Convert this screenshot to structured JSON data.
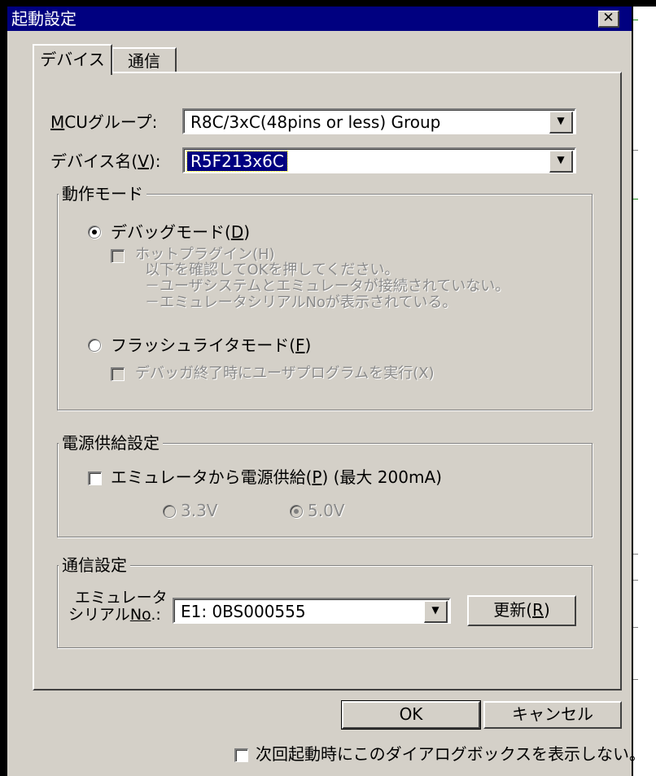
{
  "window": {
    "title": "起動設定",
    "close_icon": "close-icon"
  },
  "tabs": [
    {
      "label": "デバイス",
      "active": true
    },
    {
      "label": "通信",
      "active": false
    }
  ],
  "mcu_group": {
    "label": "MCUグループ:",
    "accel": "M",
    "value": "R8C/3xC(48pins or less) Group"
  },
  "device_name": {
    "label_pre": "デバイス名(",
    "accel": "V",
    "label_post": "):",
    "value": "R5F213x6C"
  },
  "operation_mode": {
    "legend": "動作モード",
    "debug_mode": {
      "label_pre": "デバッグモード(",
      "accel": "D",
      "label_post": ")",
      "checked": true
    },
    "hot_plugin": {
      "label": "ホットプラグイン(H)",
      "note_line1": "以下を確認してOKを押してください。",
      "note_line2": "－ユーザシステムとエミュレータが接続されていない。",
      "note_line3": "－エミュレータシリアルNoが表示されている。",
      "enabled": false,
      "checked": false
    },
    "flash_writer_mode": {
      "label_pre": "フラッシュライタモード(",
      "accel": "F",
      "label_post": ")",
      "checked": false
    },
    "run_user_program": {
      "label": "デバッガ終了時にユーザプログラムを実行(X)",
      "enabled": false,
      "checked": false
    }
  },
  "power_supply": {
    "legend": "電源供給設定",
    "supply_from_emulator": {
      "label_pre": "エミュレータから電源供給(",
      "accel": "P",
      "label_post": ") (最大 200mA)",
      "checked": false
    },
    "voltage_3v3": {
      "label": "3.3V",
      "checked": false,
      "enabled": false
    },
    "voltage_5v0": {
      "label": "5.0V",
      "checked": true,
      "enabled": false
    }
  },
  "comm_settings": {
    "legend": "通信設定",
    "serial_label_line1": "エミュレータ",
    "serial_label_line2_pre": "シリアル",
    "serial_label_accel": "No",
    "serial_label_line2_post": ".:",
    "serial_value": "E1: 0BS000555",
    "refresh_button_pre": "更新(",
    "refresh_button_accel": "R",
    "refresh_button_post": ")"
  },
  "buttons": {
    "ok": "OK",
    "cancel": "キャンセル"
  },
  "dont_show_again": {
    "label": "次回起動時にこのダイアログボックスを表示しない。",
    "checked": false
  },
  "colors": {
    "title_bar": "#000080",
    "dialog_face": "#d4d0c8",
    "selection": "#000080"
  }
}
